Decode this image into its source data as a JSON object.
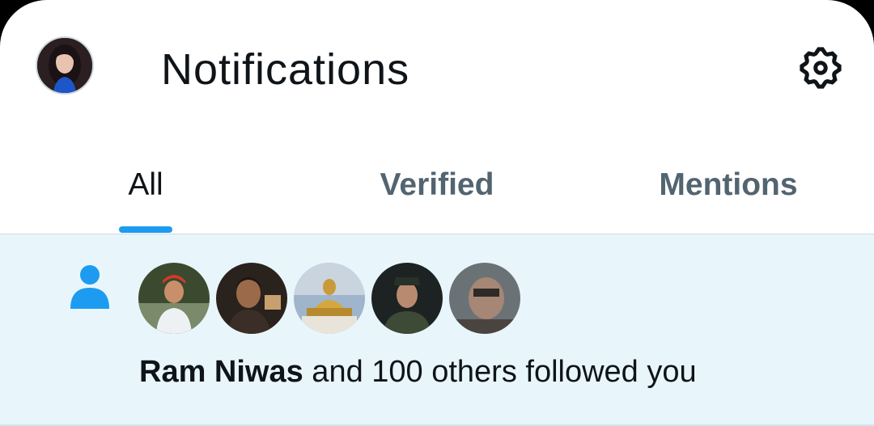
{
  "header": {
    "title": "Notifications",
    "avatar_icon": "profile-avatar",
    "settings_icon": "gear-icon"
  },
  "tabs": [
    {
      "label": "All",
      "active": true
    },
    {
      "label": "Verified",
      "active": false
    },
    {
      "label": "Mentions",
      "active": false
    }
  ],
  "notification": {
    "type_icon": "person-icon",
    "actor_name": "Ram Niwas",
    "message": " and 100 others followed you",
    "follower_avatars": [
      "avatar-1",
      "avatar-2",
      "avatar-3",
      "avatar-4",
      "avatar-5"
    ]
  },
  "colors": {
    "accent": "#1d9bf0",
    "text_primary": "#0f1419",
    "text_secondary": "#536471",
    "highlight_bg": "#e8f6fc"
  }
}
